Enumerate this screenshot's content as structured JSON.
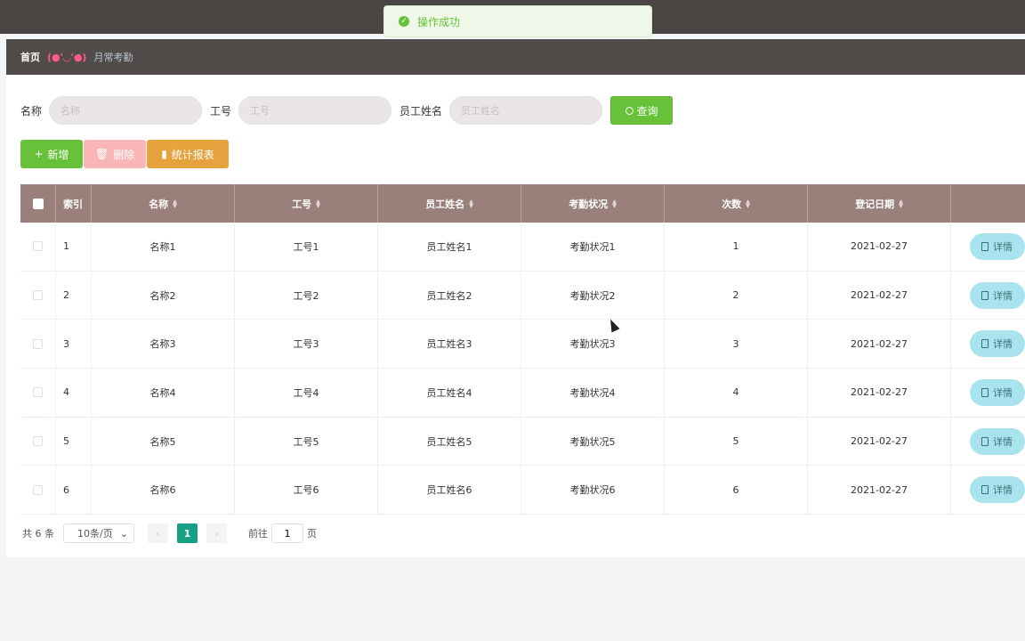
{
  "toast": {
    "message": "操作成功"
  },
  "breadcrumb": {
    "home": "首页",
    "face": "(●'◡'●)",
    "current": "月常考勤"
  },
  "search": {
    "fields": [
      {
        "label": "名称",
        "placeholder": "名称"
      },
      {
        "label": "工号",
        "placeholder": "工号"
      },
      {
        "label": "员工姓名",
        "placeholder": "员工姓名"
      }
    ],
    "query_label": "查询"
  },
  "actions": {
    "add": "新增",
    "delete": "删除",
    "report": "统计报表"
  },
  "table": {
    "columns": [
      "索引",
      "名称",
      "工号",
      "员工姓名",
      "考勤状况",
      "次数",
      "登记日期"
    ],
    "rows": [
      {
        "idx": "1",
        "name": "名称1",
        "no": "工号1",
        "emp": "员工姓名1",
        "status": "考勤状况1",
        "count": "1",
        "date": "2021-02-27"
      },
      {
        "idx": "2",
        "name": "名称2",
        "no": "工号2",
        "emp": "员工姓名2",
        "status": "考勤状况2",
        "count": "2",
        "date": "2021-02-27"
      },
      {
        "idx": "3",
        "name": "名称3",
        "no": "工号3",
        "emp": "员工姓名3",
        "status": "考勤状况3",
        "count": "3",
        "date": "2021-02-27"
      },
      {
        "idx": "4",
        "name": "名称4",
        "no": "工号4",
        "emp": "员工姓名4",
        "status": "考勤状况4",
        "count": "4",
        "date": "2021-02-27"
      },
      {
        "idx": "5",
        "name": "名称5",
        "no": "工号5",
        "emp": "员工姓名5",
        "status": "考勤状况5",
        "count": "5",
        "date": "2021-02-27"
      },
      {
        "idx": "6",
        "name": "名称6",
        "no": "工号6",
        "emp": "员工姓名6",
        "status": "考勤状况6",
        "count": "6",
        "date": "2021-02-27"
      }
    ],
    "detail_label": "详情"
  },
  "pagination": {
    "total": "共 6 条",
    "page_size": "10条/页",
    "current_page": "1",
    "goto_prefix": "前往",
    "goto_value": "1",
    "goto_suffix": "页"
  },
  "colors": {
    "header_bg": "#9a807b",
    "success": "#67c23a",
    "danger_light": "#fab6b6",
    "warning": "#e6a23c",
    "detail_bg": "#a9e4ee",
    "page_active": "#16a085"
  }
}
